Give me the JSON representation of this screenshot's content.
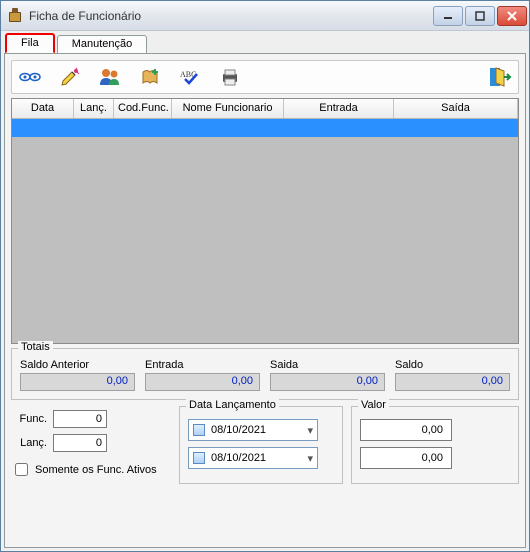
{
  "window": {
    "title": "Ficha de Funcionário"
  },
  "tabs": {
    "fila": "Fila",
    "manutencao": "Manutenção"
  },
  "grid": {
    "headers": {
      "data": "Data",
      "lanc": "Lanç.",
      "codfunc": "Cod.Func.",
      "nome": "Nome Funcionario",
      "entrada": "Entrada",
      "saida": "Saída"
    },
    "rows": []
  },
  "totais": {
    "legend": "Totais",
    "saldo_anterior_label": "Saldo Anterior",
    "saldo_anterior": "0,00",
    "entrada_label": "Entrada",
    "entrada": "0,00",
    "saida_label": "Saida",
    "saida": "0,00",
    "saldo_label": "Saldo",
    "saldo": "0,00"
  },
  "filters": {
    "func_label": "Func.",
    "func": "0",
    "lanc_label": "Lanç.",
    "lanc": "0",
    "somente_ativos_label": "Somente os Func. Ativos",
    "somente_ativos": false,
    "data_lanc_legend": "Data Lançamento",
    "data_from": "08/10/2021",
    "data_to": "08/10/2021",
    "valor_legend": "Valor",
    "valor_from": "0,00",
    "valor_to": "0,00"
  }
}
